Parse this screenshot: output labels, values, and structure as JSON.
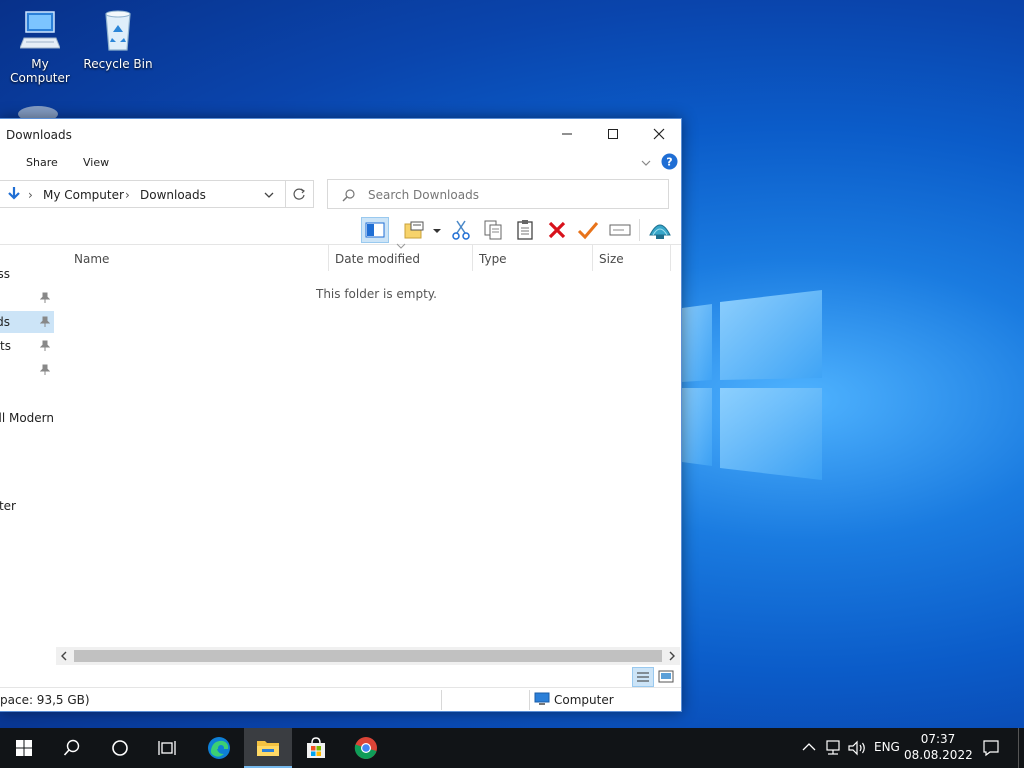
{
  "desktop": {
    "icons": [
      {
        "label": "My Computer",
        "icon": "computer-icon"
      },
      {
        "label": "Recycle Bin",
        "icon": "recycle-bin-icon"
      }
    ]
  },
  "window": {
    "title": "Downloads",
    "ribbon_tabs": [
      "Share",
      "View"
    ],
    "address": {
      "root": "My Computer",
      "current": "Downloads"
    },
    "search_placeholder": "Search Downloads",
    "nav_items": [
      {
        "label": "ss",
        "pinned": false
      },
      {
        "label": "",
        "pinned": true
      },
      {
        "label": "ds",
        "pinned": true,
        "selected": true
      },
      {
        "label": "nts",
        "pinned": true
      },
      {
        "label": "",
        "pinned": true
      },
      {
        "label": "ell Modern",
        "pinned": false
      },
      {
        "label": "uter",
        "pinned": false
      }
    ],
    "columns": [
      "Name",
      "Date modified",
      "Type",
      "Size"
    ],
    "empty_message": "This folder is empty.",
    "status_left": "pace: 93,5 GB)",
    "status_right": "Computer"
  },
  "taskbar": {
    "language": "ENG",
    "time": "07:37",
    "date": "08.08.2022"
  },
  "colors": {
    "accent": "#0078d7",
    "delete_red": "#d8121b",
    "check_orange": "#e8731a",
    "taskbar_bg": "#111417"
  }
}
